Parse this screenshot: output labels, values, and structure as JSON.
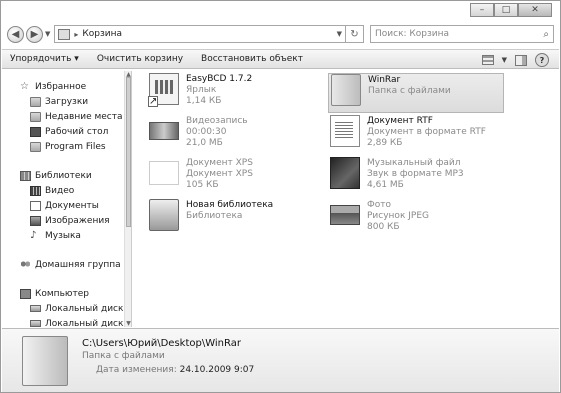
{
  "window": {
    "caption_minimize": "–",
    "caption_maximize": "□",
    "caption_close": "✕"
  },
  "address": {
    "path": "Корзина",
    "search_placeholder": "Поиск: Корзина"
  },
  "toolbar": {
    "organize": "Упорядочить ▾",
    "empty_bin": "Очистить корзину",
    "restore": "Восстановить объект"
  },
  "nav": {
    "favorites": {
      "label": "Избранное",
      "items": [
        "Загрузки",
        "Недавние места",
        "Рабочий стол",
        "Program Files"
      ]
    },
    "libraries": {
      "label": "Библиотеки",
      "items": [
        "Видео",
        "Документы",
        "Изображения",
        "Музыка"
      ]
    },
    "homegroup": "Домашняя группа",
    "computer": {
      "label": "Компьютер",
      "items": [
        "Локальный диск (C:)",
        "Локальный диск (D:)"
      ]
    }
  },
  "files": [
    {
      "name": "EasyBCD 1.7.2",
      "line2": "Ярлык",
      "line3": "1,14 КБ"
    },
    {
      "name": "Видеозапись",
      "line2": "00:00:30",
      "line3": "21,0 МБ"
    },
    {
      "name": "Документ XPS",
      "line2": "Документ XPS",
      "line3": "105 КБ"
    },
    {
      "name": "Новая библиотека",
      "line2": "Библиотека",
      "line3": ""
    },
    {
      "name": "WinRar",
      "line2": "Папка с файлами",
      "line3": ""
    },
    {
      "name": "Документ RTF",
      "line2": "Документ в формате RTF",
      "line3": "2,89 КБ"
    },
    {
      "name": "Музыкальный файл",
      "line2": "Звук в формате MP3",
      "line3": "4,61 МБ"
    },
    {
      "name": "Фото",
      "line2": "Рисунок JPEG",
      "line3": "800 КБ"
    }
  ],
  "details": {
    "path": "C:\\Users\\Юрий\\Desktop\\WinRar",
    "type": "Папка с файлами",
    "date_label": "Дата изменения:",
    "date_value": "24.10.2009 9:07"
  }
}
